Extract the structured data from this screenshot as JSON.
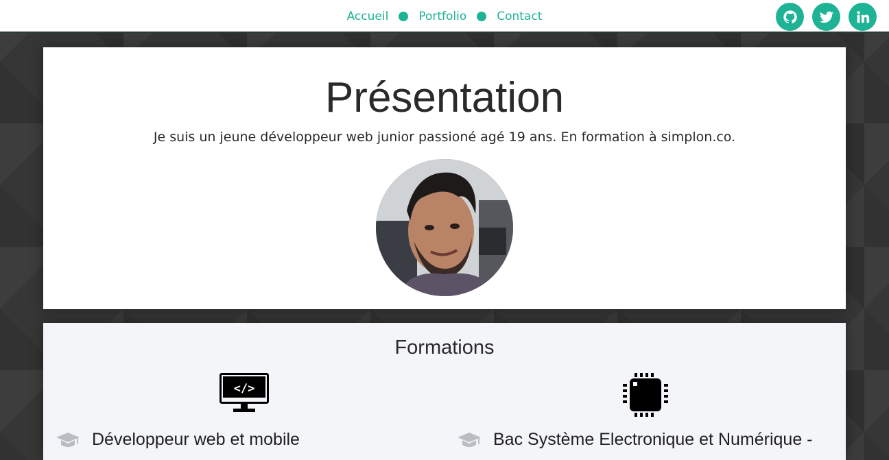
{
  "nav": {
    "items": [
      {
        "label": "Accueil"
      },
      {
        "label": "Portfolio"
      },
      {
        "label": "Contact"
      }
    ]
  },
  "socials": [
    {
      "icon": "github-icon"
    },
    {
      "icon": "twitter-icon"
    },
    {
      "icon": "linkedin-icon"
    }
  ],
  "presentation": {
    "title": "Présentation",
    "text": "Je suis un jeune développeur web junior passioné agé 19 ans. En formation à simplon.co."
  },
  "formations": {
    "title": "Formations",
    "items": [
      {
        "icon": "code-monitor-icon",
        "label": "Développeur web et mobile"
      },
      {
        "icon": "microchip-icon",
        "label": "Bac Système Electronique et Numérique -"
      }
    ]
  },
  "colors": {
    "accent": "#1db394",
    "background": "#363636"
  }
}
